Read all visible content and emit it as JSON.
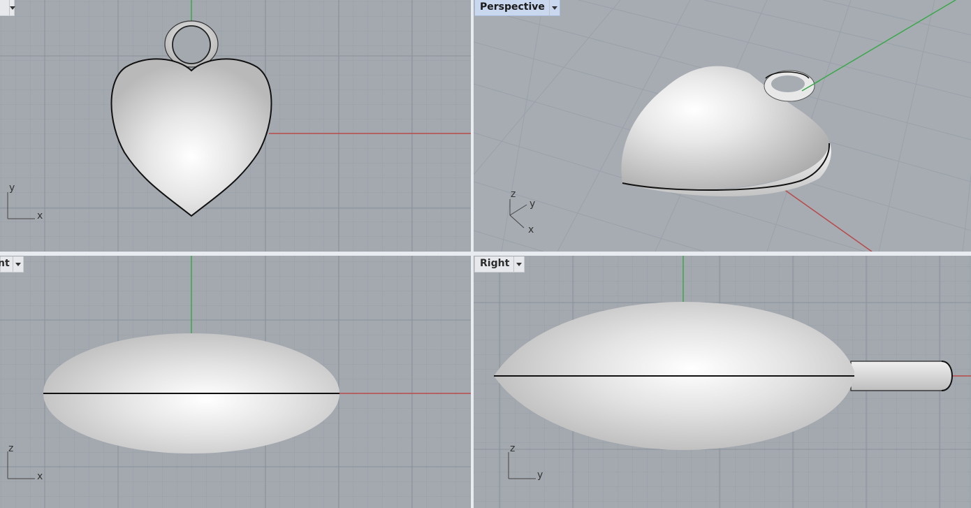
{
  "viewports": {
    "top": {
      "label": "",
      "axes": [
        "x",
        "y"
      ]
    },
    "persp": {
      "label": "Perspective",
      "axes": [
        "x",
        "y",
        "z"
      ]
    },
    "front": {
      "label": "nt",
      "axes": [
        "x",
        "z"
      ]
    },
    "right": {
      "label": "Right",
      "axes": [
        "y",
        "z"
      ]
    }
  },
  "colors": {
    "background": "#a4a9b0",
    "grid_minor": "#98a0a8",
    "grid_major": "#8a9199",
    "x_axis": "#b84a4a",
    "y_axis": "#3aa84a",
    "active_label": "#c9d8ee"
  },
  "icons": [
    "dropdown-arrow-icon",
    "axis-widget-icon"
  ]
}
